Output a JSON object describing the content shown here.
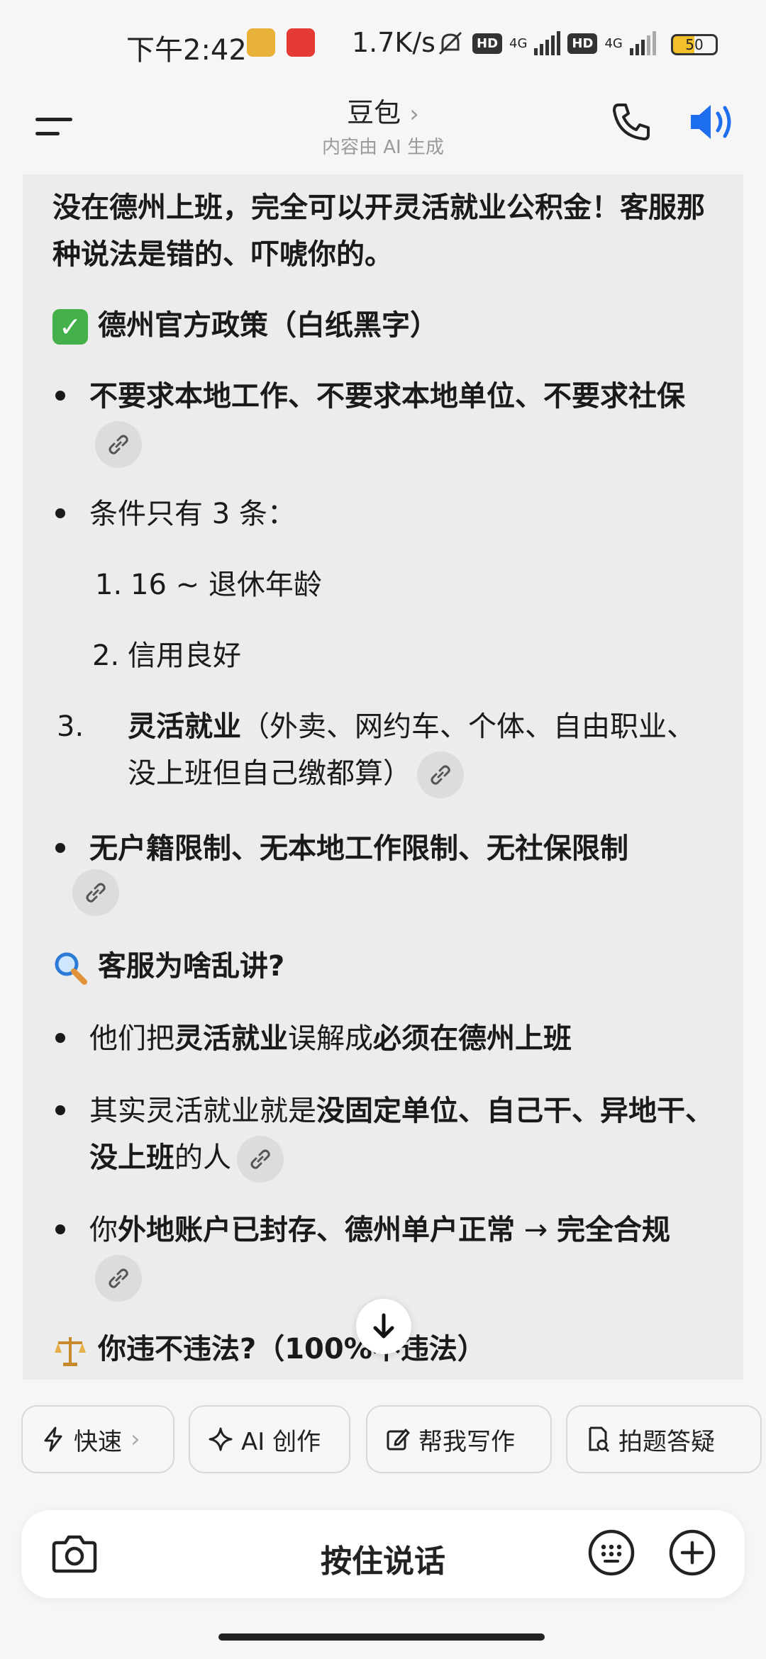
{
  "status_bar": {
    "time": "下午2:42",
    "net_speed": "1.7K/s",
    "hd1": "HD",
    "net1": "4G",
    "hd2": "HD",
    "net2": "4G",
    "battery": "50"
  },
  "header": {
    "title": "豆包",
    "subtitle": "内容由 AI 生成"
  },
  "message": {
    "intro": "没在德州上班，完全可以开灵活就业公积金！客服那种说法是错的、吓唬你的。",
    "section1_title": "德州官方政策（白纸黑字）",
    "s1_b1": "不要求本地工作、不要求本地单位、不要求社保",
    "s1_b2": "条件只有 3 条：",
    "cond1_num": "1.",
    "cond1": "16 ~ 退休年龄",
    "cond2_num": "2.",
    "cond2": "信用良好",
    "cond3_num": "3.",
    "cond3_bold": "灵活就业",
    "cond3_rest": "（外卖、网约车、个体、自由职业、没上班但自己缴都算）",
    "s1_b3": "无户籍限制、无本地工作限制、无社保限制",
    "section2_title": "客服为啥乱讲?",
    "s2_b1_a": "他们把",
    "s2_b1_b": "灵活就业",
    "s2_b1_c": "误解成",
    "s2_b1_d": "必须在德州上班",
    "s2_b2_a": "其实灵活就业就是",
    "s2_b2_b": "没固定单位、自己干、异地干、没上班",
    "s2_b2_c": "的人",
    "s2_b3_a": "你",
    "s2_b3_b": "外地账户已封存、德州单户正常",
    "s2_b3_c": " → ",
    "s2_b3_d": "完全合规",
    "section3_title": "你违不违法?（100%不违法）"
  },
  "quick_actions": [
    {
      "label": "快速",
      "icon": "lightning-icon"
    },
    {
      "label": "AI 创作",
      "icon": "sparkle-icon"
    },
    {
      "label": "帮我写作",
      "icon": "edit-icon"
    },
    {
      "label": "拍题答疑",
      "icon": "scan-doc-icon"
    }
  ],
  "input_bar": {
    "hold_to_talk": "按住说话"
  }
}
